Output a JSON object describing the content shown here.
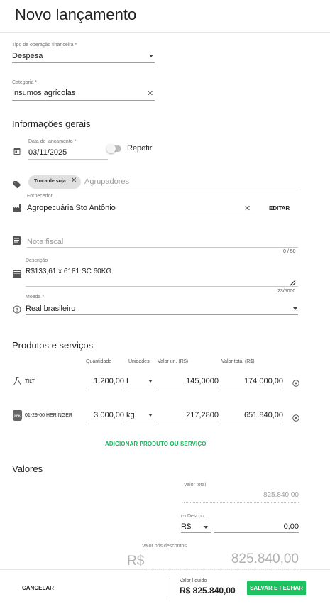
{
  "header": {
    "title": "Novo lançamento"
  },
  "tipo_operacao": {
    "label": "Tipo de operação financeira *",
    "value": "Despesa"
  },
  "categoria": {
    "label": "Categoria *",
    "value": "Insumos agrícolas"
  },
  "informacoes_gerais": {
    "title": "Informações gerais",
    "data": {
      "label": "Data de lançamento *",
      "value": "03/11/2025"
    },
    "repetir": {
      "label": "Repetir",
      "checked": false
    },
    "agrupadores": {
      "chip": "Troca de soja",
      "placeholder": "Agrupadores"
    },
    "fornecedor": {
      "label": "Fornecedor",
      "value": "Agropecuária Sto Antônio",
      "edit_label": "EDITAR"
    },
    "nota_fiscal": {
      "placeholder": "Nota fiscal",
      "counter": "0 / 50"
    },
    "descricao": {
      "label": "Descrição",
      "value": "R$133,61 x 6181 SC 60KG",
      "counter": "23/5000"
    },
    "moeda": {
      "label": "Moeda *",
      "value": "Real brasileiro"
    }
  },
  "produtos": {
    "title": "Produtos e serviços",
    "headers": {
      "quantidade": "Quantidade",
      "unidades": "Unidades",
      "valor_un": "Valor un. (R$)",
      "valor_total": "Valor total (R$)"
    },
    "rows": [
      {
        "name": "TILT",
        "quantidade": "1.200,00",
        "unidade": "L",
        "valor_un": "145,0000",
        "valor_total": "174.000,00",
        "icon": "flask-icon"
      },
      {
        "name": "01-29-00 HERINGER",
        "quantidade": "3.000,00",
        "unidade": "kg",
        "valor_un": "217,2800",
        "valor_total": "651.840,00",
        "icon": "fertilizer-bag-icon",
        "icon_text": "NPK"
      }
    ],
    "add_label": "ADICIONAR PRODUTO OU SERVIÇO"
  },
  "valores": {
    "title": "Valores",
    "valor_total": {
      "label": "Valor total",
      "value": "825.840,00"
    },
    "desconto": {
      "label": "(-) Descon...",
      "currency": "R$",
      "value": "0,00"
    },
    "pos_descontos": {
      "label": "Valor pós descontos",
      "currency": "R$",
      "value": "825.840,00"
    }
  },
  "footer": {
    "cancel_label": "CANCELAR",
    "liquido_label": "Valor líquido",
    "liquido_value": "R$ 825.840,00",
    "save_label": "SALVAR E FECHAR"
  },
  "colors": {
    "accent": "#1ec160",
    "chip_bg": "#e0e0e0"
  }
}
